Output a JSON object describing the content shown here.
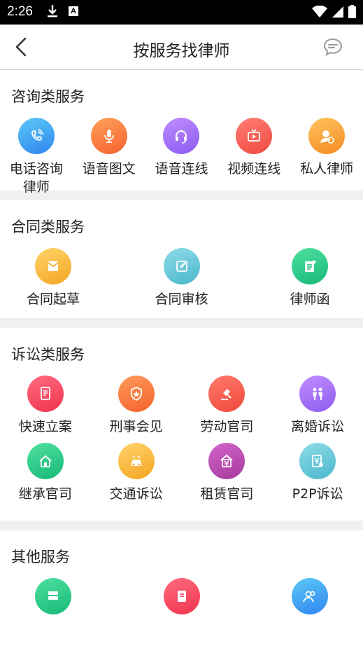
{
  "status_bar": {
    "time": "2:26"
  },
  "header": {
    "title": "按服务找律师"
  },
  "sections": [
    {
      "title": "咨询类服务",
      "items": [
        {
          "label": "电话咨询\n律师",
          "icon": "phone-icon",
          "color_from": "#5cc8f7",
          "color_to": "#2f86f0"
        },
        {
          "label": "语音图文",
          "icon": "microphone-icon",
          "color_from": "#ffa15a",
          "color_to": "#f5622e"
        },
        {
          "label": "语音连线",
          "icon": "headset-icon",
          "color_from": "#c08dff",
          "color_to": "#8a5bf0"
        },
        {
          "label": "视频连线",
          "icon": "tv-icon",
          "color_from": "#ff7d73",
          "color_to": "#ef4b43"
        },
        {
          "label": "私人律师",
          "icon": "lawyer-icon",
          "color_from": "#ffc45f",
          "color_to": "#f58a23"
        }
      ]
    },
    {
      "title": "合同类服务",
      "items": [
        {
          "label": "合同起草",
          "icon": "envelope-icon",
          "color_from": "#ffd36b",
          "color_to": "#f5a623"
        },
        {
          "label": "合同审核",
          "icon": "edit-icon",
          "color_from": "#8edce8",
          "color_to": "#4ab7cc"
        },
        {
          "label": "律师函",
          "icon": "letter-icon",
          "color_from": "#4fe0a0",
          "color_to": "#17b978"
        }
      ]
    },
    {
      "title": "诉讼类服务",
      "items": [
        {
          "label": "快速立案",
          "icon": "file-icon",
          "color_from": "#ff6b7f",
          "color_to": "#f0344e"
        },
        {
          "label": "刑事会见",
          "icon": "shield-icon",
          "color_from": "#ff9a5a",
          "color_to": "#f5632e"
        },
        {
          "label": "劳动官司",
          "icon": "gavel-icon",
          "color_from": "#ff7a6a",
          "color_to": "#ef4a3d"
        },
        {
          "label": "离婚诉讼",
          "icon": "couple-icon",
          "color_from": "#c48dff",
          "color_to": "#8b5cf0"
        },
        {
          "label": "继承官司",
          "icon": "house-icon",
          "color_from": "#4fe0a0",
          "color_to": "#17b978"
        },
        {
          "label": "交通诉讼",
          "icon": "car-icon",
          "color_from": "#ffd36b",
          "color_to": "#f5a623"
        },
        {
          "label": "租赁官司",
          "icon": "rent-icon",
          "color_from": "#d064c8",
          "color_to": "#a83a9e"
        },
        {
          "label": "P2P诉讼",
          "icon": "money-icon",
          "color_from": "#8edce8",
          "color_to": "#4ab7cc"
        }
      ]
    },
    {
      "title": "其他服务",
      "items": [
        {
          "label": "",
          "icon": "server-icon",
          "color_from": "#4fe0a0",
          "color_to": "#17b978"
        },
        {
          "label": "",
          "icon": "document-icon",
          "color_from": "#ff6b7f",
          "color_to": "#f0344e"
        },
        {
          "label": "",
          "icon": "users-icon",
          "color_from": "#5cc8f7",
          "color_to": "#2f86f0"
        }
      ]
    }
  ]
}
